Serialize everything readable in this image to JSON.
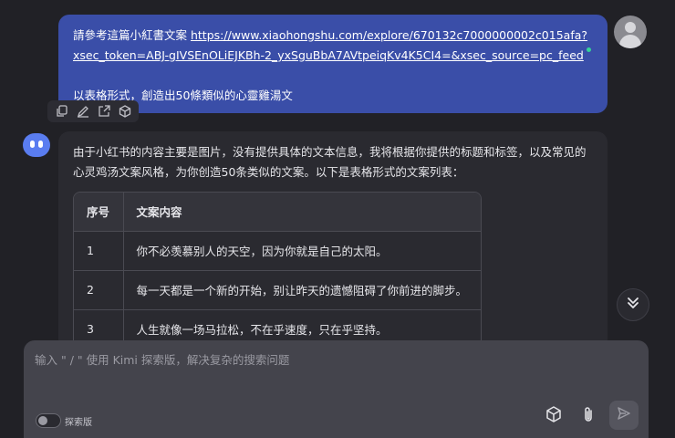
{
  "user_message": {
    "prefix": "請參考這篇小紅書文案 ",
    "link_line1": "https://www.xiaohongshu.com/explore/670132c7000000002c015afa?",
    "link_line2": "xsec_token=ABJ-gIVSEnOLiEJKBh-2_yxSguBbA7AVtpeiqKv4K5CI4=&xsec_source=pc_feed",
    "instruction": "以表格形式，創造出50條類似的心靈雞湯文"
  },
  "message_tools": {
    "icons": [
      "copy-icon",
      "edit-icon",
      "share-icon",
      "cube-icon"
    ]
  },
  "bot_message": {
    "line1": "由于小红书的内容主要是图片，没有提供具体的文本信息，我将根据你提供的标题和标签，以及常见的",
    "line2": "心灵鸡汤文案风格，为你创造50条类似的文案。以下是表格形式的文案列表：",
    "table": {
      "headers": [
        "序号",
        "文案内容"
      ],
      "rows": [
        [
          "1",
          "你不必羡慕别人的天空，因为你就是自己的太阳。"
        ],
        [
          "2",
          "每一天都是一个新的开始，别让昨天的遗憾阻碍了你前进的脚步。"
        ],
        [
          "3",
          "人生就像一场马拉松，不在乎速度，只在乎坚持。"
        ]
      ]
    }
  },
  "composer": {
    "placeholder": "输入 \" / \" 使用 Kimi 探索版，解决复杂的搜索问题",
    "toggle_label": "探索版"
  },
  "colors": {
    "background": "#212126",
    "user_bubble": "#3a4ea8",
    "bot_bubble": "#2a2a30",
    "composer": "#44444c",
    "bot_avatar": "#5a7df0"
  }
}
